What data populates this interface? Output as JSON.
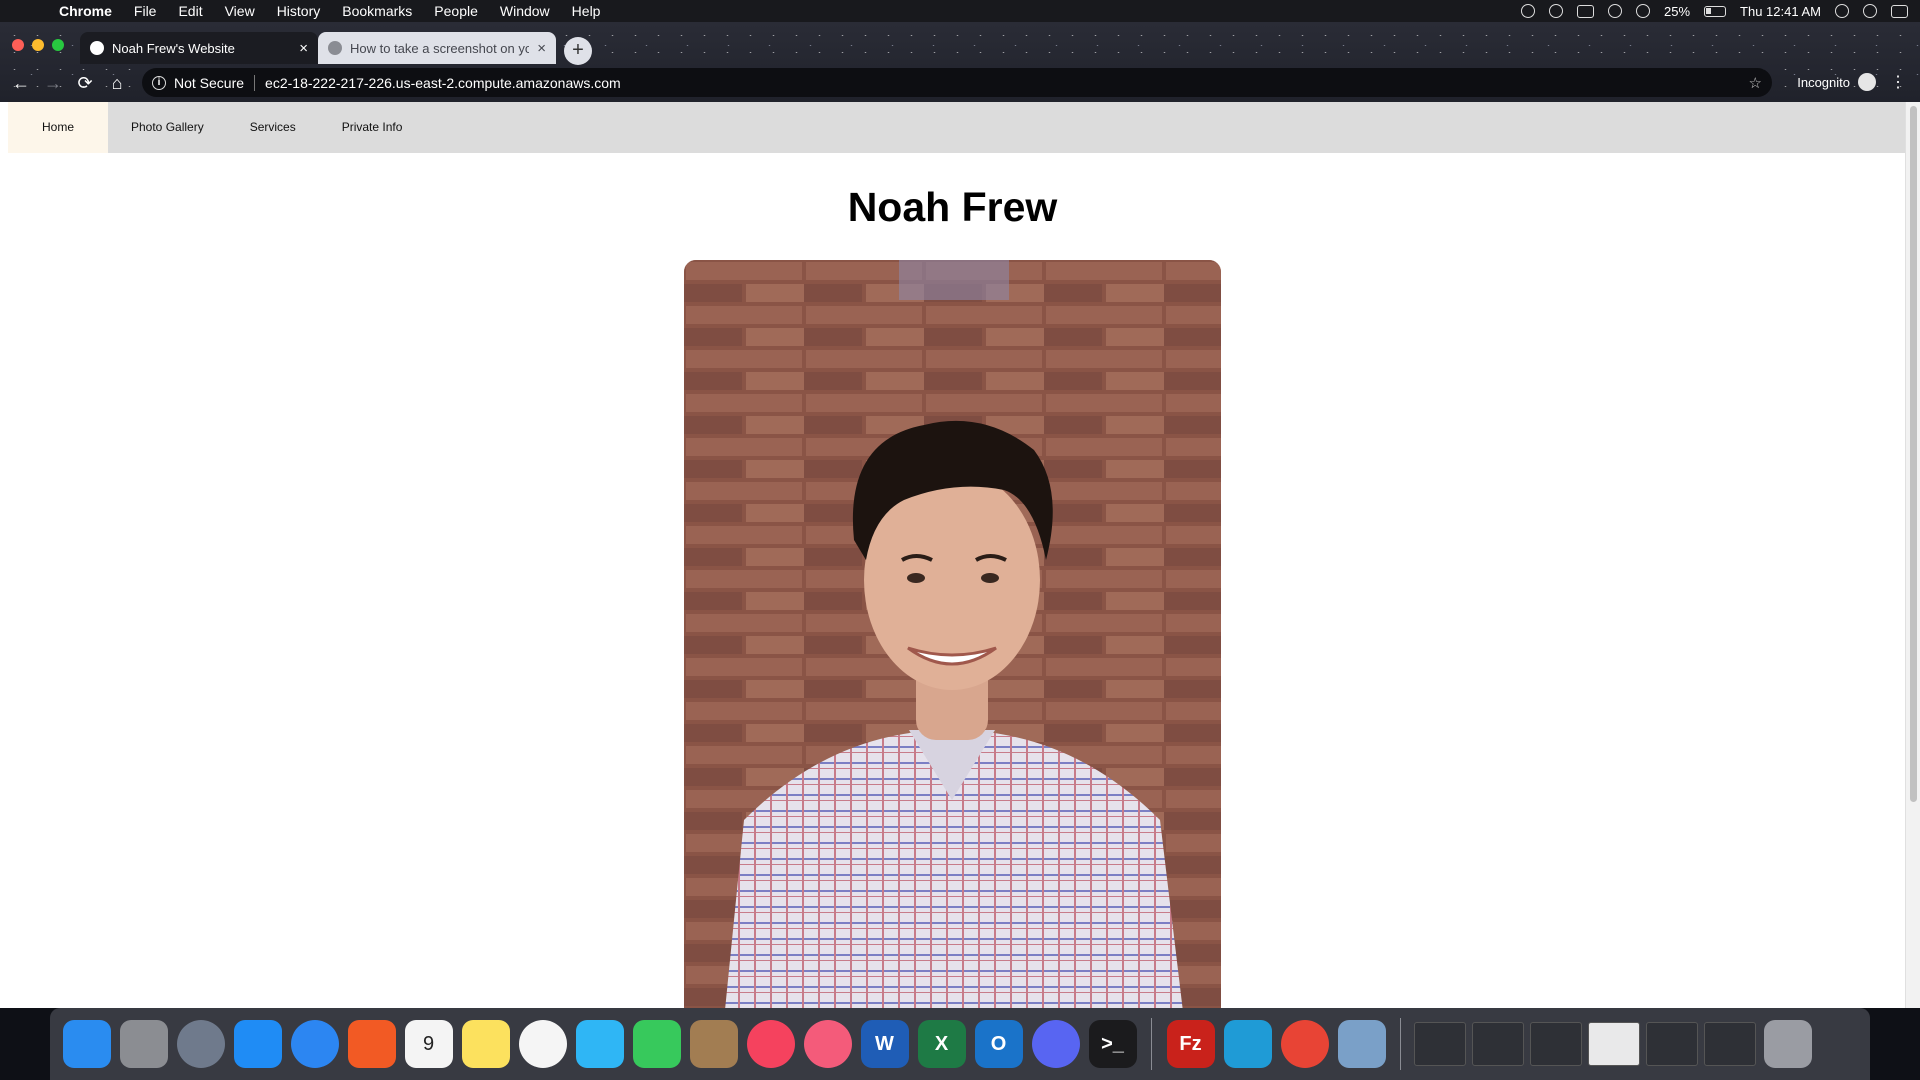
{
  "menubar": {
    "apple_glyph": "",
    "items": [
      "Chrome",
      "File",
      "Edit",
      "View",
      "History",
      "Bookmarks",
      "People",
      "Window",
      "Help"
    ],
    "battery_percent": "25%",
    "clock": "Thu 12:41 AM"
  },
  "browser": {
    "tabs": [
      {
        "title": "Noah Frew's Website",
        "close": "×"
      },
      {
        "title": "How to take a screenshot on your Mac",
        "close": "×"
      }
    ],
    "new_tab": "+",
    "nav": {
      "back": "←",
      "forward": "→",
      "reload": "⟳",
      "home": "⌂"
    },
    "security_label": "Not Secure",
    "info_glyph": "i",
    "url": "ec2-18-222-217-226.us-east-2.compute.amazonaws.com",
    "star": "☆",
    "incognito_label": "Incognito",
    "menu_glyph": "⋮"
  },
  "site": {
    "nav_items": [
      "Home",
      "Photo Gallery",
      "Services",
      "Private Info"
    ],
    "title": "Noah Frew"
  },
  "dock": {
    "apps": [
      {
        "icon": "finder-icon",
        "color": "#2a8cf0"
      },
      {
        "icon": "system-preferences-icon",
        "color": "#8b8d92"
      },
      {
        "icon": "launchpad-icon",
        "color": "#6f7a8c"
      },
      {
        "icon": "app-store-icon",
        "color": "#1f8cf5"
      },
      {
        "icon": "safari-icon",
        "color": "#2c86f2"
      },
      {
        "icon": "brave-icon",
        "color": "#f25a24"
      },
      {
        "icon": "calendar-icon",
        "color": "#f4f4f4",
        "text": "9"
      },
      {
        "icon": "notes-icon",
        "color": "#fce15e"
      },
      {
        "icon": "photos-icon",
        "color": "#f5f5f5"
      },
      {
        "icon": "messages-icon",
        "color": "#2fb6f5"
      },
      {
        "icon": "facetime-icon",
        "color": "#37c95c"
      },
      {
        "icon": "contacts-icon",
        "color": "#a27d52"
      },
      {
        "icon": "news-icon",
        "color": "#f5425e"
      },
      {
        "icon": "music-icon",
        "color": "#f45b7a"
      },
      {
        "icon": "word-icon",
        "color": "#1f5db6",
        "text": "W"
      },
      {
        "icon": "excel-icon",
        "color": "#1e7a45",
        "text": "X"
      },
      {
        "icon": "outlook-icon",
        "color": "#1a73c9",
        "text": "O"
      },
      {
        "icon": "discord-icon",
        "color": "#5865f2"
      },
      {
        "icon": "terminal-icon",
        "color": "#1b1b1d",
        "text": ">_"
      },
      {
        "icon": "filezilla-icon",
        "color": "#c9221b",
        "text": "Fz"
      },
      {
        "icon": "vmware-icon",
        "color": "#1f9bd6"
      },
      {
        "icon": "chrome-icon",
        "color": "#e84435"
      },
      {
        "icon": "preview-icon",
        "color": "#7aa0c8"
      }
    ],
    "windows": [
      "window-thumbnail",
      "window-thumbnail",
      "window-thumbnail",
      "window-thumbnail",
      "window-thumbnail",
      "window-thumbnail"
    ],
    "trash": "trash-icon"
  }
}
